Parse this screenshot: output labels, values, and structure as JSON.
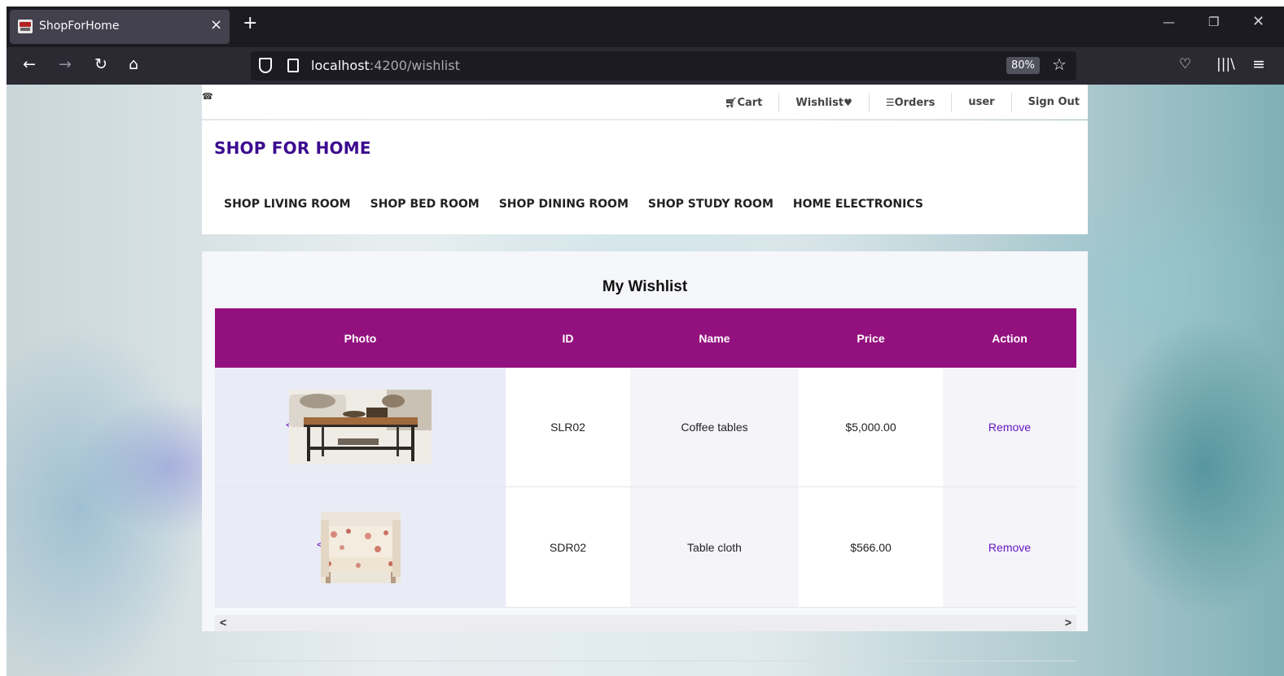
{
  "browser": {
    "tab_title": "ShopForHome",
    "tab_close": "×",
    "new_tab": "+",
    "url_host": "localhost",
    "url_path": ":4200/wishlist",
    "zoom": "80%",
    "icons": [
      "back-icon",
      "forward-icon",
      "reload-icon",
      "home-icon",
      "shield-icon",
      "page-icon",
      "bookmark-star-icon",
      "pocket-icon",
      "library-icon",
      "menu-icon",
      "minimize-icon",
      "restore-icon",
      "close-icon"
    ]
  },
  "topbar": {
    "cart": "Cart",
    "wishlist": "Wishlist",
    "orders": "Orders",
    "user": "user",
    "sign_out": "Sign Out"
  },
  "header": {
    "brand": "SHOP FOR HOME",
    "categories": [
      "SHOP LIVING ROOM",
      "SHOP BED ROOM",
      "SHOP DINING ROOM",
      "SHOP STUDY ROOM",
      "HOME ELECTRONICS"
    ]
  },
  "wishlist": {
    "title": "My Wishlist",
    "columns": [
      "Photo",
      "ID",
      "Name",
      "Price",
      "Action"
    ],
    "rows": [
      {
        "id": "SLR02",
        "name": "Coffee tables",
        "price": "$5,000.00",
        "action": "Remove"
      },
      {
        "id": "SDR02",
        "name": "Table cloth",
        "price": "$566.00",
        "action": "Remove"
      }
    ]
  },
  "colors": {
    "header_purple": "#93117e",
    "brand_indigo": "#3b0b8f",
    "link_purple": "#6a16c4"
  }
}
